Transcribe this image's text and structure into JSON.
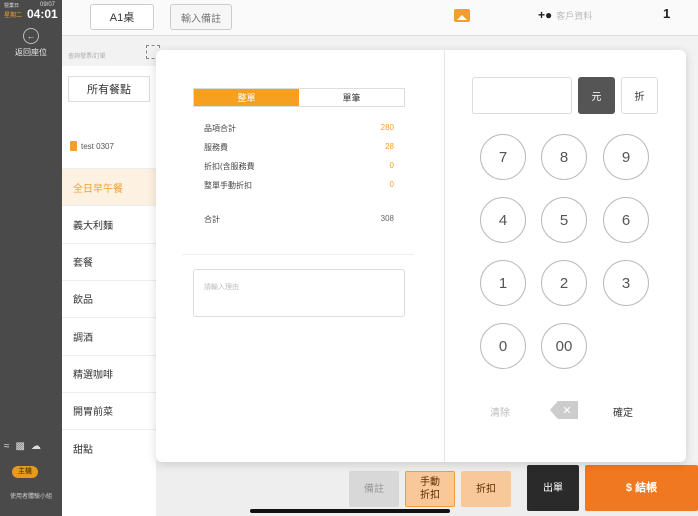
{
  "status": {
    "business_label": "營業日",
    "date": "09/07",
    "weekday": "星期二",
    "time": "04:01"
  },
  "rail": {
    "back_label": "返回座位",
    "host_badge": "主機",
    "user_label": "使用者體驗小組"
  },
  "topbar": {
    "table": "A1桌",
    "note_button": "輸入備註",
    "customer": "客戶資料",
    "guests": "1"
  },
  "sidebar": {
    "search_placeholder": "查詢發票/訂單",
    "all_meals": "所有餐點",
    "menu_name": "test 0307",
    "categories": [
      "全日早午餐",
      "義大利麵",
      "套餐",
      "飲品",
      "調酒",
      "精選咖啡",
      "開胃前菜",
      "甜點"
    ],
    "active_index": 0
  },
  "modal": {
    "seg_whole": "整單",
    "seg_single": "單筆",
    "rows": [
      {
        "label": "品項合計",
        "value": "280"
      },
      {
        "label": "服務費",
        "value": "28"
      },
      {
        "label": "折扣(含服務費",
        "value": "0"
      },
      {
        "label": "整單手動折扣",
        "value": "0"
      }
    ],
    "total_label": "合計",
    "total_value": "308",
    "reason_placeholder": "請輸入理由",
    "unit_yuan": "元",
    "unit_zhe": "折",
    "keys": [
      "7",
      "8",
      "9",
      "4",
      "5",
      "6",
      "1",
      "2",
      "3",
      "0",
      "00"
    ],
    "clear": "清除",
    "confirm": "確定"
  },
  "bottombar": {
    "note": "備註",
    "manual_discount": "手動\n折扣",
    "discount": "折扣",
    "checkout": "出單",
    "pay": "$ 結帳"
  },
  "colors": {
    "accent": "#f5a020",
    "pay": "#f07820",
    "dark": "#4a4a4a"
  }
}
